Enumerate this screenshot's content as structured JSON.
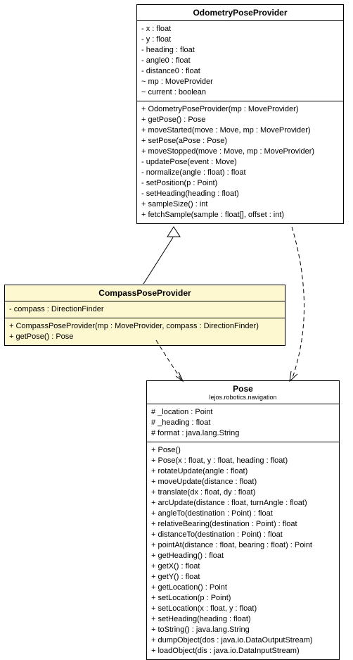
{
  "classes": {
    "odometry": {
      "name": "OdometryPoseProvider",
      "attributes": [
        "- x : float",
        "- y : float",
        "- heading : float",
        "- angle0 : float",
        "- distance0 : float",
        "~ mp : MoveProvider",
        "~ current : boolean"
      ],
      "operations": [
        "+ OdometryPoseProvider(mp : MoveProvider)",
        "+ getPose() : Pose",
        "+ moveStarted(move : Move, mp : MoveProvider)",
        "+ setPose(aPose : Pose)",
        "+ moveStopped(move : Move, mp : MoveProvider)",
        "- updatePose(event : Move)",
        "- normalize(angle : float) : float",
        "- setPosition(p : Point)",
        "- setHeading(heading : float)",
        "+ sampleSize() : int",
        "+ fetchSample(sample : float[], offset : int)"
      ]
    },
    "compass": {
      "name": "CompassPoseProvider",
      "attributes": [
        "- compass : DirectionFinder"
      ],
      "operations": [
        "+ CompassPoseProvider(mp : MoveProvider, compass : DirectionFinder)",
        "+ getPose() : Pose"
      ]
    },
    "pose": {
      "name": "Pose",
      "package": "lejos.robotics.navigation",
      "attributes": [
        "# _location : Point",
        "# _heading : float",
        "# format : java.lang.String"
      ],
      "operations": [
        "+ Pose()",
        "+ Pose(x : float, y : float, heading : float)",
        "+ rotateUpdate(angle : float)",
        "+ moveUpdate(distance : float)",
        "+ translate(dx : float, dy : float)",
        "+ arcUpdate(distance : float, turnAngle : float)",
        "+ angleTo(destination : Point) : float",
        "+ relativeBearing(destination : Point) : float",
        "+ distanceTo(destination : Point) : float",
        "+ pointAt(distance : float, bearing : float) : Point",
        "+ getHeading() : float",
        "+ getX() : float",
        "+ getY() : float",
        "+ getLocation() : Point",
        "+ setLocation(p : Point)",
        "+ setLocation(x : float, y : float)",
        "+ setHeading(heading : float)",
        "+ toString() : java.lang.String",
        "+ dumpObject(dos : java.io.DataOutputStream)",
        "+ loadObject(dis : java.io.DataInputStream)"
      ]
    }
  }
}
